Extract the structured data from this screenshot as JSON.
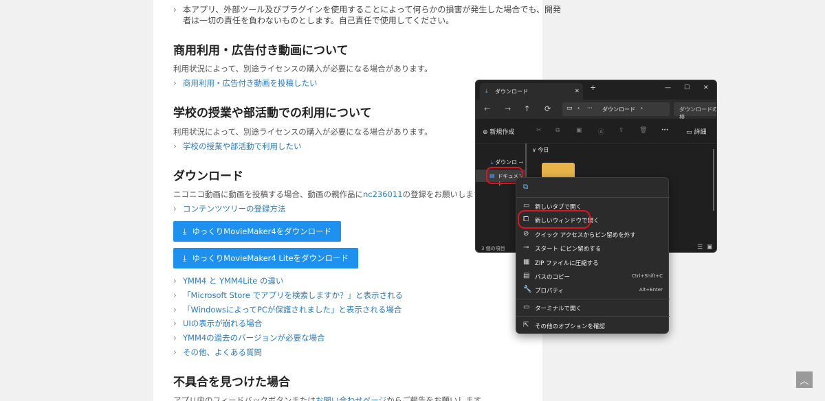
{
  "article": {
    "disclaimer_line1": "本アプリ、外部ツール及びプラグインを使用することによって何らかの損害が発生した場合でも、開発",
    "disclaimer_line2": "者は一切の責任を負わないものとします。自己責任で使用してください。",
    "commercial": {
      "heading": "商用利用・広告付き動画について",
      "text": "利用状況によって、別途ライセンスの購入が必要になる場合があります。",
      "link": "商用利用・広告付き動画を投稿したい"
    },
    "school": {
      "heading": "学校の授業や部活動での利用について",
      "text": "利用状況によって、別途ライセンスの購入が必要になる場合があります。",
      "link": "学校の授業や部活動で利用したい"
    },
    "download": {
      "heading": "ダウンロード",
      "text_before": "ニコニコ動画に動画を投稿する場合、動画の親作品に",
      "text_link": "nc236011",
      "text_after": "の登録をお願いします。",
      "tree_link": "コンテンツツリーの登録方法",
      "button1": "ゆっくりMovieMaker4をダウンロード",
      "button2": "ゆっくりMovieMaker4 Liteをダウンロード",
      "faq_links": [
        "YMM4 と YMM4Lite の違い",
        "「Microsoft Store でアプリを検索しますか？」と表示される",
        "「WindowsによってPCが保護されました」と表示される場合",
        "UIの表示が崩れる場合",
        "YMM4の過去のバージョンが必要な場合",
        "その他、よくある質問"
      ]
    },
    "bug": {
      "heading": "不具合を見つけた場合",
      "text_before": "アプリ内のフィードバックボタンまたは",
      "text_link": "お問い合わせページ",
      "text_after": "からご報告をお願いします。"
    }
  },
  "scroll_top_icon": "chevron-up-icon",
  "explorer": {
    "tab_title": "ダウンロード",
    "tab_close": "✕",
    "new_tab": "+",
    "window_buttons": [
      "—",
      "☐",
      "✕"
    ],
    "nav_icons": [
      "←",
      "→",
      "↑",
      "⟳"
    ],
    "breadcrumb_more": "···",
    "breadcrumb": "ダウンロード",
    "search_placeholder": "ダウンロードの検",
    "new_button": "新規作成",
    "details_button": "詳細",
    "sidebar_downloads": "ダウンロ",
    "sidebar_documents": "ドキュメント",
    "group_today": "今日",
    "status_count": "3 個の項目"
  },
  "context_menu": {
    "items": [
      {
        "label": "新しいタブで開く",
        "icon": "tab-icon",
        "shortcut": ""
      },
      {
        "label": "新しいウィンドウで開く",
        "icon": "open-window-icon",
        "shortcut": ""
      },
      {
        "label": "クイック アクセスからピン留めを外す",
        "icon": "unpin-icon",
        "shortcut": ""
      },
      {
        "label": "スタート にピン留めする",
        "icon": "pin-icon",
        "shortcut": ""
      },
      {
        "label": "ZIP ファイルに圧縮する",
        "icon": "zip-icon",
        "shortcut": ""
      },
      {
        "label": "パスのコピー",
        "icon": "copy-path-icon",
        "shortcut": "Ctrl+Shift+C"
      },
      {
        "label": "プロパティ",
        "icon": "properties-icon",
        "shortcut": "Alt+Enter"
      },
      {
        "label": "ターミナルで開く",
        "icon": "terminal-icon",
        "shortcut": ""
      },
      {
        "label": "その他のオプションを確認",
        "icon": "more-options-icon",
        "shortcut": ""
      }
    ]
  },
  "colors": {
    "accent": "#1e90f0",
    "link": "#2a7bc0",
    "highlight": "#e0141e",
    "explorer_bg": "#1f1f1f"
  }
}
